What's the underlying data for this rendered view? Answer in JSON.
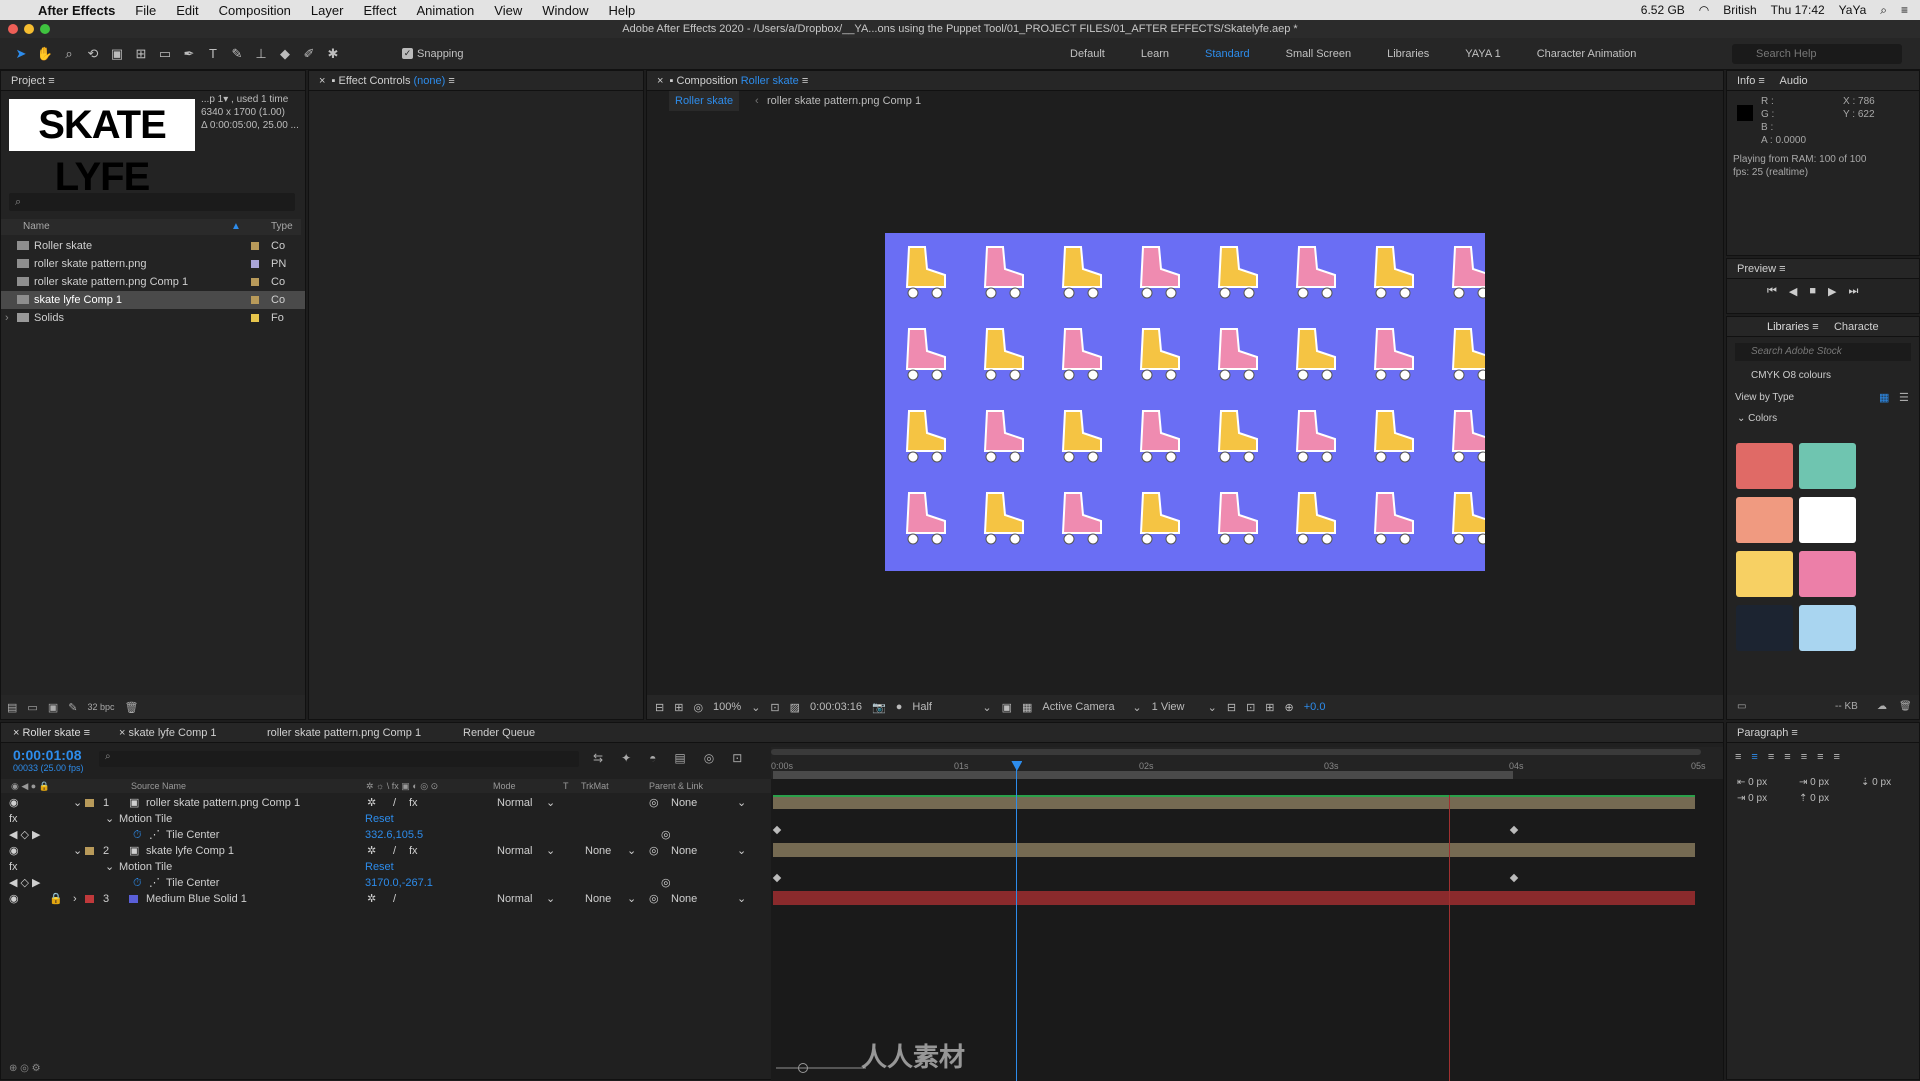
{
  "menubar": {
    "app": "After Effects",
    "items": [
      "File",
      "Edit",
      "Composition",
      "Layer",
      "Effect",
      "Animation",
      "View",
      "Window",
      "Help"
    ],
    "memory": "6.52 GB",
    "lang": "British",
    "clock": "Thu 17:42",
    "user": "YaYa"
  },
  "titlebar": {
    "text": "Adobe After Effects 2020 - /Users/a/Dropbox/__YA...ons using the Puppet Tool/01_PROJECT FILES/01_AFTER EFFECTS/Skatelyfe.aep *"
  },
  "toolbar": {
    "snapping": "Snapping",
    "workspaces": [
      "Default",
      "Learn",
      "Standard",
      "Small Screen",
      "Libraries",
      "YAYA 1",
      "Character Animation"
    ],
    "active_workspace": "Standard",
    "search_placeholder": "Search Help"
  },
  "project": {
    "tab": "Project",
    "logo": "SKATE LYFE",
    "info_line1": "...p 1▾ , used 1 time",
    "info_line2": "6340 x 1700 (1.00)",
    "info_line3": "Δ 0:00:05:00, 25.00 ...",
    "col_name": "Name",
    "col_type": "Type",
    "items": [
      {
        "name": "Roller skate",
        "type": "Co",
        "color": "#b89a5a"
      },
      {
        "name": "roller skate pattern.png",
        "type": "PN",
        "color": "#a9a4d6"
      },
      {
        "name": "roller skate pattern.png Comp 1",
        "type": "Co",
        "color": "#b89a5a"
      },
      {
        "name": "skate lyfe Comp 1",
        "type": "Co",
        "color": "#b89a5a"
      },
      {
        "name": "Solids",
        "type": "Fo",
        "color": "#e6c54c"
      }
    ],
    "bpc": "32 bpc"
  },
  "effect_controls": {
    "tab": "Effect Controls",
    "target": "(none)"
  },
  "composition": {
    "tab": "Composition",
    "name": "Roller skate",
    "breadcrumb_1": "Roller skate",
    "breadcrumb_2": "roller skate pattern.png Comp 1",
    "zoom": "100%",
    "timecode": "0:00:03:16",
    "resolution": "Half",
    "camera": "Active Camera",
    "views": "1 View",
    "exposure": "+0.0"
  },
  "info": {
    "tab": "Info",
    "tab2": "Audio",
    "r": "R :",
    "g": "G :",
    "b": "B :",
    "a": "A :  0.0000",
    "x": "X : 786",
    "y": "Y : 622",
    "playing": "Playing from RAM: 100 of 100",
    "fps": "fps: 25 (realtime)"
  },
  "preview": {
    "tab": "Preview"
  },
  "libraries": {
    "tab": "Libraries",
    "tab2": "Characte",
    "search_placeholder": "Search Adobe Stock",
    "library": "CMYK O8 colours",
    "view_by": "View by Type",
    "section": "Colors",
    "colors": [
      "#e06a66",
      "#6fc5b0",
      "#f09a80",
      "#ffffff",
      "#f7d063",
      "#ec7fa8",
      "#1c2431",
      "#a9d5f0"
    ],
    "size": "-- KB"
  },
  "paragraph": {
    "tab": "Paragraph",
    "values": [
      "0 px",
      "0 px",
      "0 px",
      "0 px",
      "0 px"
    ]
  },
  "timeline": {
    "tabs": [
      "Roller skate",
      "skate lyfe Comp 1",
      "roller skate pattern.png Comp 1",
      "Render Queue"
    ],
    "timecode": "0:00:01:08",
    "frames": "00033 (25.00 fps)",
    "col_source": "Source Name",
    "col_mode": "Mode",
    "col_t": "T",
    "col_trkmat": "TrkMat",
    "col_parent": "Parent & Link",
    "ruler": [
      "0:00s",
      "01s",
      "02s",
      "03s",
      "04s",
      "05s"
    ],
    "layers": [
      {
        "num": "1",
        "name": "roller skate pattern.png Comp 1",
        "mode": "Normal",
        "trkmat": "",
        "parent": "None",
        "color": "#b89a5a",
        "effect": "Motion Tile",
        "reset": "Reset",
        "prop": "Tile Center",
        "value": "332.6,105.5"
      },
      {
        "num": "2",
        "name": "skate lyfe Comp 1",
        "mode": "Normal",
        "trkmat": "None",
        "parent": "None",
        "color": "#b89a5a",
        "effect": "Motion Tile",
        "reset": "Reset",
        "prop": "Tile Center",
        "value": "3170.0,-267.1"
      },
      {
        "num": "3",
        "name": "Medium Blue Solid 1",
        "mode": "Normal",
        "trkmat": "None",
        "parent": "None",
        "color": "#c0393b"
      }
    ],
    "playhead_seconds": 1.32,
    "duration_seconds": 5
  },
  "watermark": {
    "text": "人人素材"
  }
}
